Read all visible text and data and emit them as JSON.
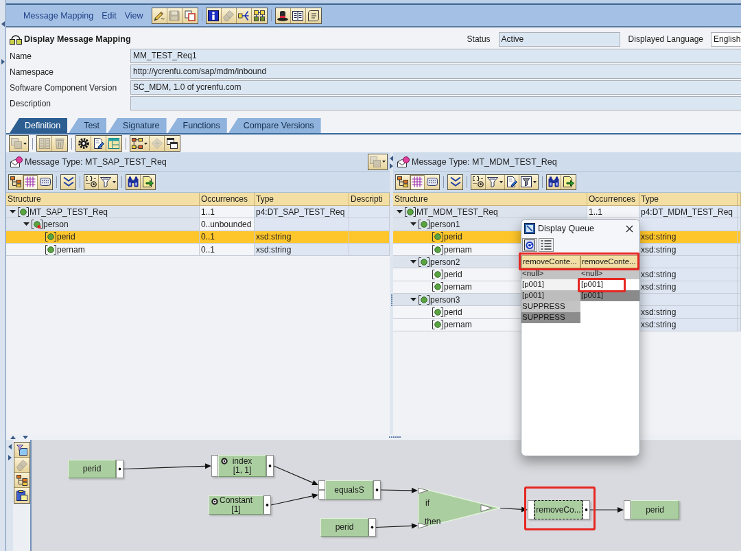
{
  "menu": [
    {
      "label": "Message Mapping"
    },
    {
      "label": "Edit"
    },
    {
      "label": "View"
    }
  ],
  "menu_toolbar": [
    [
      {
        "kind": "edit",
        "disabled": false
      },
      {
        "kind": "save",
        "disabled": true
      },
      {
        "kind": "copy",
        "disabled": false
      }
    ],
    [
      {
        "kind": "info",
        "disabled": false
      },
      {
        "kind": "erase",
        "disabled": true
      },
      {
        "kind": "route",
        "disabled": false
      },
      {
        "kind": "mapping",
        "disabled": false
      }
    ],
    [
      {
        "kind": "hat",
        "disabled": false
      },
      {
        "kind": "book",
        "disabled": false
      },
      {
        "kind": "scroll",
        "disabled": false
      }
    ]
  ],
  "header": {
    "title": "Display Message Mapping",
    "status_label": "Status",
    "status": "Active",
    "language_label": "Displayed Language",
    "language": "English"
  },
  "fields": [
    {
      "label": "Name",
      "value": "MM_TEST_Req1"
    },
    {
      "label": "Namespace",
      "value": "http://ycrenfu.com/sap/mdm/inbound"
    },
    {
      "label": "Software Component Version",
      "value": "SC_MDM, 1.0 of ycrenfu.com"
    },
    {
      "label": "Description"
    }
  ],
  "tabs": [
    {
      "label": "Definition",
      "selected": true
    },
    {
      "label": "Test",
      "selected": false
    },
    {
      "label": "Signature",
      "selected": false
    },
    {
      "label": "Functions",
      "selected": false
    },
    {
      "label": "Compare Versions",
      "selected": false
    }
  ],
  "toolbar": [
    [
      {
        "kind": "pages",
        "disabled": true,
        "dropdown": true
      }
    ],
    [
      {
        "kind": "columns",
        "disabled": true,
        "dropdown": false
      },
      {
        "kind": "trash",
        "disabled": true,
        "dropdown": false
      }
    ],
    [
      {
        "kind": "gear",
        "disabled": false,
        "dropdown": false
      },
      {
        "kind": "docedit",
        "disabled": false,
        "dropdown": false
      },
      {
        "kind": "layout",
        "disabled": false,
        "dropdown": false
      }
    ],
    [
      {
        "kind": "flow",
        "disabled": false,
        "dropdown": true
      },
      {
        "kind": "diamond",
        "disabled": true,
        "dropdown": false
      },
      {
        "kind": "windows",
        "disabled": false,
        "dropdown": false
      }
    ]
  ],
  "source": {
    "title": "Message Type: MT_SAP_TEST_Req",
    "header_button": {
      "kind": "pages",
      "disabled": true,
      "dropdown": true
    },
    "toolbar": [
      [
        {
          "kind": "tree",
          "pressed": false,
          "dropdown": false
        },
        {
          "kind": "grid",
          "pressed": true,
          "dropdown": false
        },
        {
          "kind": "src",
          "pressed": false,
          "dropdown": false
        }
      ],
      [
        {
          "kind": "chevrons",
          "pressed": false,
          "dropdown": false
        }
      ],
      [
        {
          "kind": "at",
          "pressed": false,
          "dropdown": false
        },
        {
          "kind": "funnel",
          "pressed": false,
          "dropdown": true
        }
      ],
      [
        {
          "kind": "binoculars",
          "pressed": false,
          "dropdown": false
        },
        {
          "kind": "export",
          "pressed": false,
          "dropdown": false
        }
      ]
    ],
    "columns": [
      "Structure",
      "Occurrences",
      "Type",
      "Descripti"
    ],
    "tree": [
      {
        "name": "MT_SAP_TEST_Req",
        "occurrences": "1..1",
        "type": "p4:DT_SAP_TEST_Req",
        "expanded": true,
        "flagged": false,
        "selected": false,
        "children": [
          {
            "name": "person",
            "occurrences": "0..unbounded",
            "expanded": true,
            "flagged": true,
            "selected": false,
            "children": [
              {
                "name": "perid",
                "occurrences": "0..1",
                "type": "xsd:string",
                "flagged": false,
                "selected": true
              },
              {
                "name": "pernam",
                "occurrences": "0..1",
                "type": "xsd:string",
                "flagged": false,
                "selected": false
              }
            ]
          }
        ]
      }
    ]
  },
  "target": {
    "title": "Message Type: MT_MDM_TEST_Req",
    "toolbar": [
      [
        {
          "kind": "tree",
          "pressed": false,
          "dropdown": false
        },
        {
          "kind": "grid",
          "pressed": true,
          "dropdown": false
        },
        {
          "kind": "src",
          "pressed": false,
          "dropdown": false
        }
      ],
      [
        {
          "kind": "chevrons",
          "pressed": false,
          "dropdown": false
        }
      ],
      [
        {
          "kind": "at",
          "pressed": false,
          "dropdown": false
        },
        {
          "kind": "funnel",
          "pressed": false,
          "dropdown": true
        },
        {
          "kind": "docedit",
          "pressed": false,
          "dropdown": false
        },
        {
          "kind": "funneltable",
          "pressed": false,
          "dropdown": true
        }
      ],
      [
        {
          "kind": "binoculars",
          "pressed": false,
          "dropdown": false
        },
        {
          "kind": "export",
          "pressed": false,
          "dropdown": false
        }
      ]
    ],
    "columns": [
      "Structure",
      "Occurrences",
      "Type"
    ],
    "tree": [
      {
        "name": "MT_MDM_TEST_Req",
        "occurrences": "1..1",
        "type": "p4:DT_MDM_TEST_Req",
        "expanded": true,
        "flagged": false,
        "selected": false,
        "children": [
          {
            "name": "person1",
            "expanded": true,
            "flagged": false,
            "selected": false,
            "children": [
              {
                "name": "perid",
                "type": "xsd:string",
                "flagged": false,
                "selected": true
              },
              {
                "name": "pernam",
                "type": "xsd:string",
                "flagged": false,
                "selected": false
              }
            ]
          },
          {
            "name": "person2",
            "expanded": true,
            "flagged": false,
            "selected": false,
            "children": [
              {
                "name": "perid",
                "type": "xsd:string",
                "flagged": false,
                "selected": false
              },
              {
                "name": "pernam",
                "type": "xsd:string",
                "flagged": false,
                "selected": false
              }
            ]
          },
          {
            "name": "person3",
            "expanded": true,
            "flagged": false,
            "selected": false,
            "children": [
              {
                "name": "perid",
                "type": "xsd:string",
                "flagged": false,
                "selected": false
              },
              {
                "name": "pernam",
                "type": "xsd:string",
                "flagged": false,
                "selected": false
              }
            ]
          }
        ]
      }
    ]
  },
  "display_queue": {
    "title": "Display Queue",
    "toolbar": [
      {
        "kind": "refresh"
      },
      {
        "kind": "list"
      }
    ],
    "columns": [
      "removeConte...",
      "removeConte..."
    ],
    "header_highlighted": true,
    "rows": [
      [
        {
          "text": "<null>",
          "color": "#c3c3c3",
          "highlighted": false
        },
        {
          "text": "<null>",
          "color": "#c6c6c6",
          "highlighted": false
        }
      ],
      [
        {
          "text": "[p001]",
          "color": "#f2f2f2",
          "highlighted": false
        },
        {
          "text": "[p001]",
          "color": "#ffffff",
          "highlighted": true
        }
      ],
      [
        {
          "text": "[p001]",
          "color": "#bdbdbd",
          "highlighted": false
        },
        {
          "text": "[p001]",
          "color": "#8a8a8a",
          "highlighted": false
        }
      ],
      [
        {
          "text": "SUPPRESS",
          "color": "#c3c3c3",
          "highlighted": false
        },
        {
          "color": "#ffffff",
          "highlighted": false
        }
      ],
      [
        {
          "text": "SUPPRESS",
          "color": "#8c8c8c",
          "highlighted": false
        },
        {
          "color": "#ffffff",
          "highlighted": false
        }
      ]
    ]
  },
  "mapping": {
    "palette": [
      {
        "kind": "funnelwin",
        "disabled": false
      },
      {
        "kind": "erase",
        "disabled": true
      },
      {
        "kind": "tree",
        "disabled": false
      },
      {
        "kind": "clipboard",
        "disabled": false
      }
    ],
    "graph": {
      "kind": "target",
      "label": "perid",
      "selected": false,
      "highlighted": false,
      "inputs": [
        {
          "kind": "function",
          "label": "removeCo...",
          "selected": true,
          "highlighted": true,
          "inputs": [
            {
              "kind": "ifthen",
              "input_labels": [
                "if",
                "then"
              ],
              "selected": false,
              "highlighted": false,
              "inputs": [
                {
                  "kind": "function",
                  "label": "equalsS",
                  "selected": false,
                  "highlighted": false,
                  "inputs": [
                    {
                      "kind": "function",
                      "label": "index",
                      "argument": "[1, 1]",
                      "selected": false,
                      "highlighted": false,
                      "inputs": [
                        {
                          "kind": "source",
                          "label": "perid",
                          "selected": false,
                          "highlighted": false
                        }
                      ]
                    },
                    {
                      "kind": "constant",
                      "label": "Constant",
                      "argument": "[1]",
                      "selected": false,
                      "highlighted": false
                    }
                  ]
                },
                {
                  "kind": "source",
                  "label": "perid",
                  "selected": false,
                  "highlighted": false
                }
              ]
            }
          ]
        }
      ]
    }
  }
}
